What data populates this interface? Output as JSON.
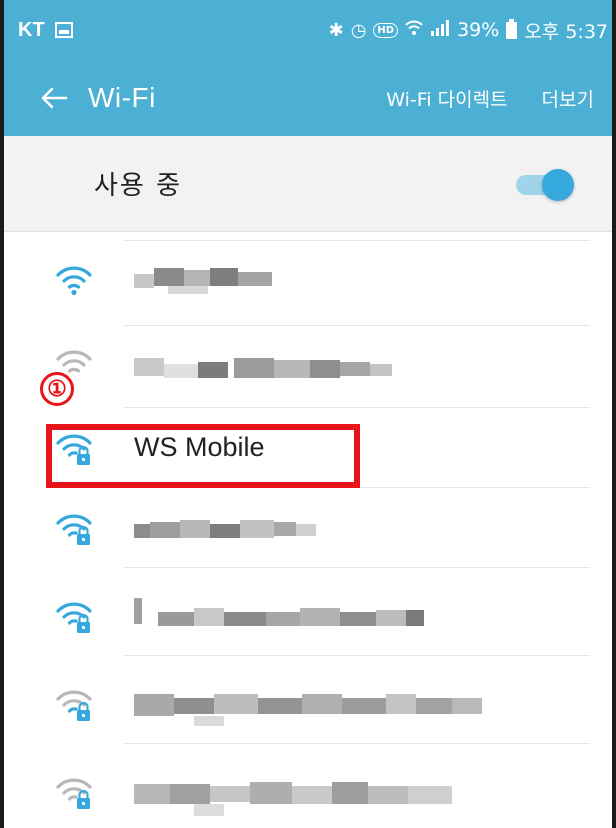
{
  "status_bar": {
    "carrier": "KT",
    "battery": "39%",
    "time": "오후 5:37"
  },
  "action_bar": {
    "title": "Wi-Fi",
    "wifi_direct_label": "Wi-Fi 다이렉트",
    "more_label": "더보기"
  },
  "toggle": {
    "label": "사용 중",
    "state": "on"
  },
  "networks": [
    {
      "name": "",
      "redacted": true,
      "secured": false
    },
    {
      "name": "",
      "redacted": true,
      "secured": false
    },
    {
      "name": "WS Mobile",
      "redacted": false,
      "secured": true
    },
    {
      "name": "",
      "redacted": true,
      "secured": true
    },
    {
      "name": "",
      "redacted": true,
      "secured": true
    },
    {
      "name": "",
      "redacted": true,
      "secured": true
    },
    {
      "name": "",
      "redacted": true,
      "secured": true
    }
  ],
  "annotation": {
    "marker": "①"
  },
  "colors": {
    "header": "#4bb0d4",
    "wifi_icon_active": "#35a8dd",
    "wifi_icon_inactive": "#b8b8b8",
    "highlight": "#e8141b",
    "toggle_on": "#35a8dd"
  }
}
